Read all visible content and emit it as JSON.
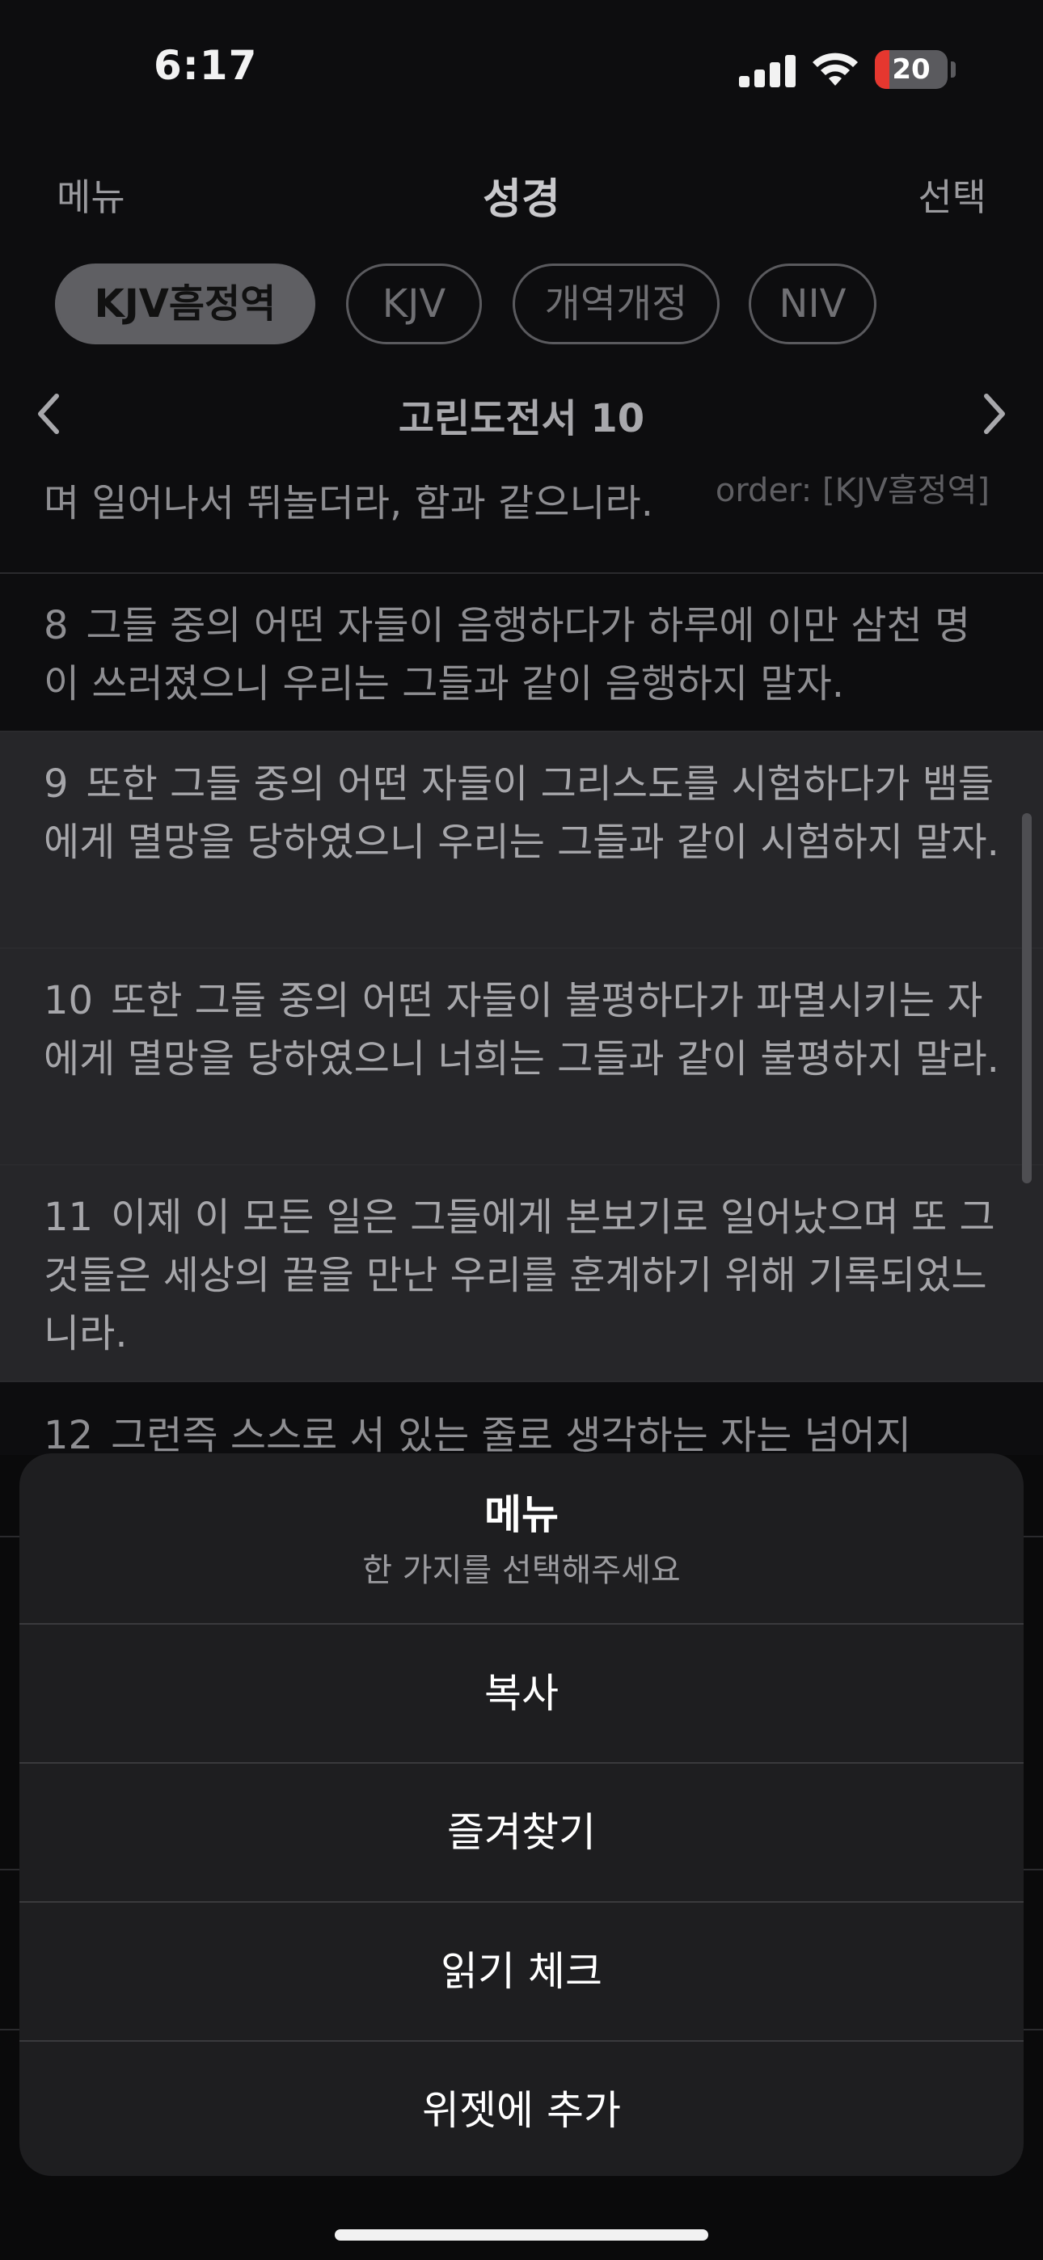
{
  "status_bar": {
    "time": "6:17",
    "battery": "20",
    "battery_level": 0.2
  },
  "nav": {
    "left": "메뉴",
    "title": "성경",
    "right": "선택"
  },
  "versions": [
    {
      "label": "KJV흠정역",
      "active": true
    },
    {
      "label": "KJV",
      "active": false
    },
    {
      "label": "개역개정",
      "active": false
    },
    {
      "label": "NIV",
      "active": false
    }
  ],
  "chapter": {
    "title": "고린도전서 10",
    "order": "order: [KJV흠정역]"
  },
  "verses": [
    {
      "num": "",
      "text": "며 일어나서 뛰놀더라, 함과 같으니라."
    },
    {
      "num": "8",
      "text": "그들 중의 어떤 자들이 음행하다가 하루에 이만 삼천 명이 쓰러졌으니 우리는 그들과 같이 음행하지 말자."
    },
    {
      "num": "9",
      "text": "또한 그들 중의 어떤 자들이 그리스도를 시험하다가 뱀들에게 멸망을 당하였으니 우리는 그들과 같이 시험하지 말자."
    },
    {
      "num": "10",
      "text": "또한 그들 중의 어떤 자들이 불평하다가 파멸시키는 자에게 멸망을 당하였으니 너희는 그들과 같이 불평하지 말라."
    },
    {
      "num": "11",
      "text": "이제 이 모든 일은 그들에게 본보기로 일어났으며 또 그것들은 세상의 끝을 만난 우리를 훈계하기 위해 기록되었느니라."
    },
    {
      "num": "12",
      "text": "그런즉 스스로 서 있는 줄로 생각하는 자는 넘어지"
    }
  ],
  "sheet": {
    "title": "메뉴",
    "subtitle": "한 가지를 선택해주세요",
    "actions": [
      "복사",
      "즐겨찾기",
      "읽기 체크",
      "위젯에 추가"
    ]
  }
}
